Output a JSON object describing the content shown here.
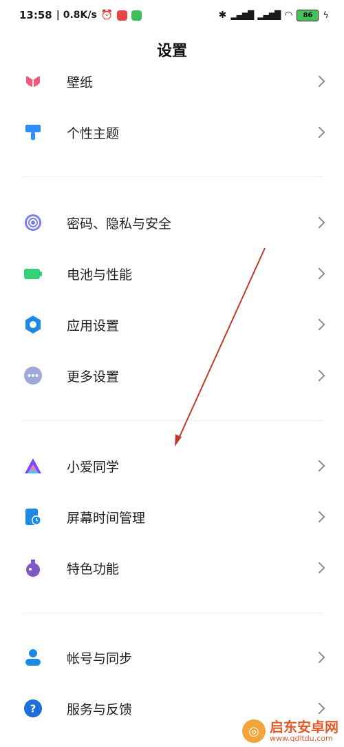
{
  "status": {
    "time": "13:58",
    "speed": "| 0.8K/s",
    "battery": "86",
    "icons": [
      "alarm-icon",
      "app-notification-icon",
      "wechat-icon",
      "bluetooth-icon",
      "signal-icon",
      "hd-signal-icon",
      "wifi-icon",
      "battery-icon",
      "charging-icon"
    ]
  },
  "page": {
    "title": "设置"
  },
  "items": [
    {
      "label": "壁纸",
      "icon": "wallpaper-icon"
    },
    {
      "label": "个性主题",
      "icon": "theme-icon"
    },
    {
      "label": "密码、隐私与安全",
      "icon": "fingerprint-icon"
    },
    {
      "label": "电池与性能",
      "icon": "battery-icon"
    },
    {
      "label": "应用设置",
      "icon": "gear-icon"
    },
    {
      "label": "更多设置",
      "icon": "more-icon"
    },
    {
      "label": "小爱同学",
      "icon": "xiaoai-icon"
    },
    {
      "label": "屏幕时间管理",
      "icon": "screen-time-icon"
    },
    {
      "label": "特色功能",
      "icon": "special-features-icon"
    },
    {
      "label": "帐号与同步",
      "icon": "account-icon"
    },
    {
      "label": "服务与反馈",
      "icon": "help-icon"
    }
  ],
  "watermark": {
    "name": "启东安卓网",
    "url": "www.qdltdu.com"
  },
  "colors": {
    "arrow": "#c0392b",
    "chevron": "#8a8a8a"
  }
}
